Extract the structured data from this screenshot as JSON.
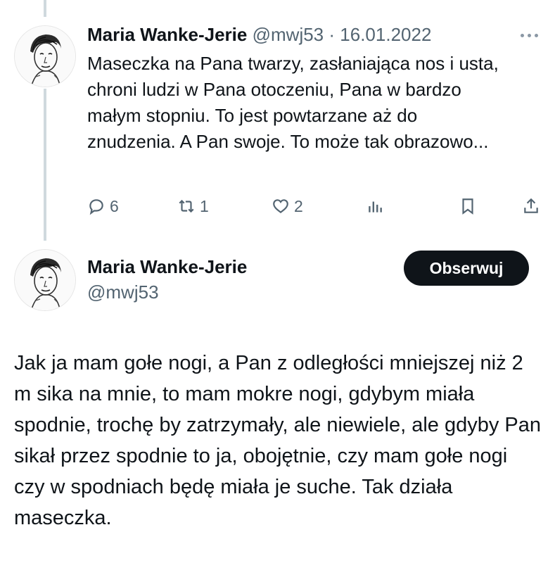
{
  "reply": {
    "author_name": "Maria Wanke-Jerie",
    "author_handle": "@mwj53",
    "separator": "·",
    "date": "16.01.2022",
    "text": "Maseczka na Pana twarzy, zasłaniająca nos i usta, chroni ludzi w Pana otoczeniu, Pana w bardzo małym stopniu. To jest powtarzane aż do znudzenia. A Pan swoje. To może tak obrazowo...",
    "actions": {
      "replies": "6",
      "retweets": "1",
      "likes": "2"
    }
  },
  "main_tweet": {
    "author_name": "Maria Wanke-Jerie",
    "author_handle": "@mwj53",
    "follow_label": "Obserwuj",
    "text": "Jak ja mam gołe nogi, a Pan z odległości mniejszej niż 2 m sika na mnie, to mam mokre nogi, gdybym miała spodnie, trochę by zatrzymały, ale niewiele, ale gdyby Pan sikał przez spodnie to ja, obojętnie, czy mam gołe nogi czy w spodniach będę miała je suche. Tak działa maseczka."
  },
  "icons": {
    "reply": "speech-bubble-icon",
    "retweet": "retweet-icon",
    "like": "heart-icon",
    "views": "bar-chart-icon",
    "bookmark": "bookmark-icon",
    "share": "share-upload-icon",
    "more": "more-dots-icon"
  },
  "colors": {
    "text": "#0f1419",
    "secondary": "#536471",
    "thread_line": "#cfd9de",
    "button_bg": "#0f1419",
    "button_text": "#ffffff"
  }
}
